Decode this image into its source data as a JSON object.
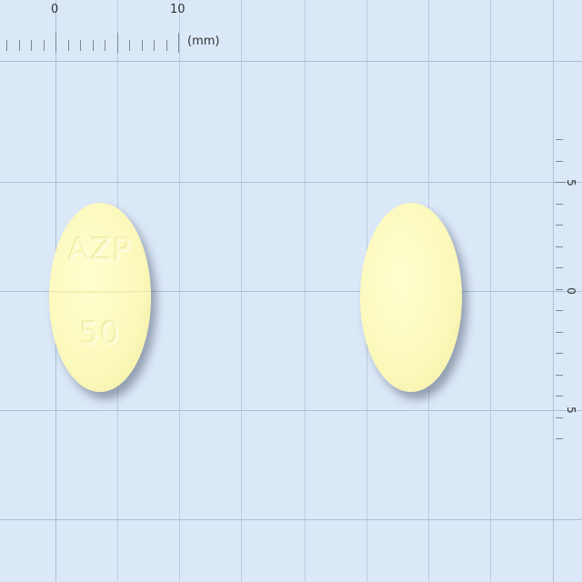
{
  "ruler_top": {
    "labels": [
      "0",
      "10"
    ],
    "unit": "(mm)"
  },
  "ruler_right": {
    "labels": [
      "5",
      "0",
      "5"
    ]
  },
  "tablets": [
    {
      "name": "tablet-front",
      "imprint_top": "AZP",
      "imprint_bottom": "50",
      "scored": true,
      "color": "#fbf8ba"
    },
    {
      "name": "tablet-back",
      "imprint_top": "",
      "imprint_bottom": "",
      "scored": false,
      "color": "#fbf8ba"
    }
  ],
  "colors": {
    "background": "#dbe8f8",
    "grid": "#bccbe0",
    "tablet": "#fbf8ba"
  }
}
